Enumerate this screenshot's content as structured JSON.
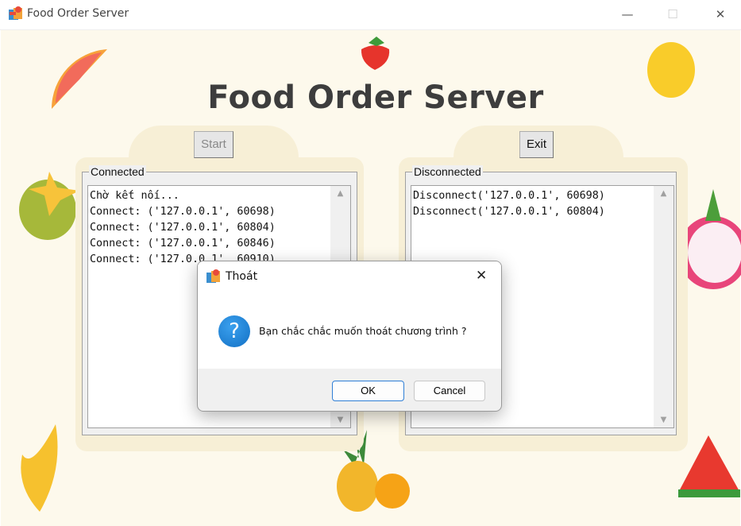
{
  "window": {
    "title": "Food Order Server",
    "minimize": "—",
    "maximize": "☐",
    "close": "✕"
  },
  "heading": "Food Order Server",
  "left": {
    "button": "Start",
    "group_label": "Connected",
    "lines": [
      "Chờ kết nối...",
      "Connect: ('127.0.0.1', 60698)",
      "Connect: ('127.0.0.1', 60804)",
      "Connect: ('127.0.0.1', 60846)",
      "Connect: ('127.0.0.1', 60910)"
    ]
  },
  "right": {
    "button": "Exit",
    "group_label": "Disconnected",
    "lines": [
      "Disconnect('127.0.0.1', 60698)",
      "Disconnect('127.0.0.1', 60804)"
    ]
  },
  "dialog": {
    "title": "Thoát",
    "message": "Bạn chắc chắc muốn thoát chương trình ?",
    "ok": "OK",
    "cancel": "Cancel",
    "close": "✕",
    "icon": "question-icon"
  },
  "colors": {
    "background": "#fdf9ec",
    "panel": "#f7efd6",
    "heading": "#3d3d3d",
    "question": "#1a7fd4"
  }
}
